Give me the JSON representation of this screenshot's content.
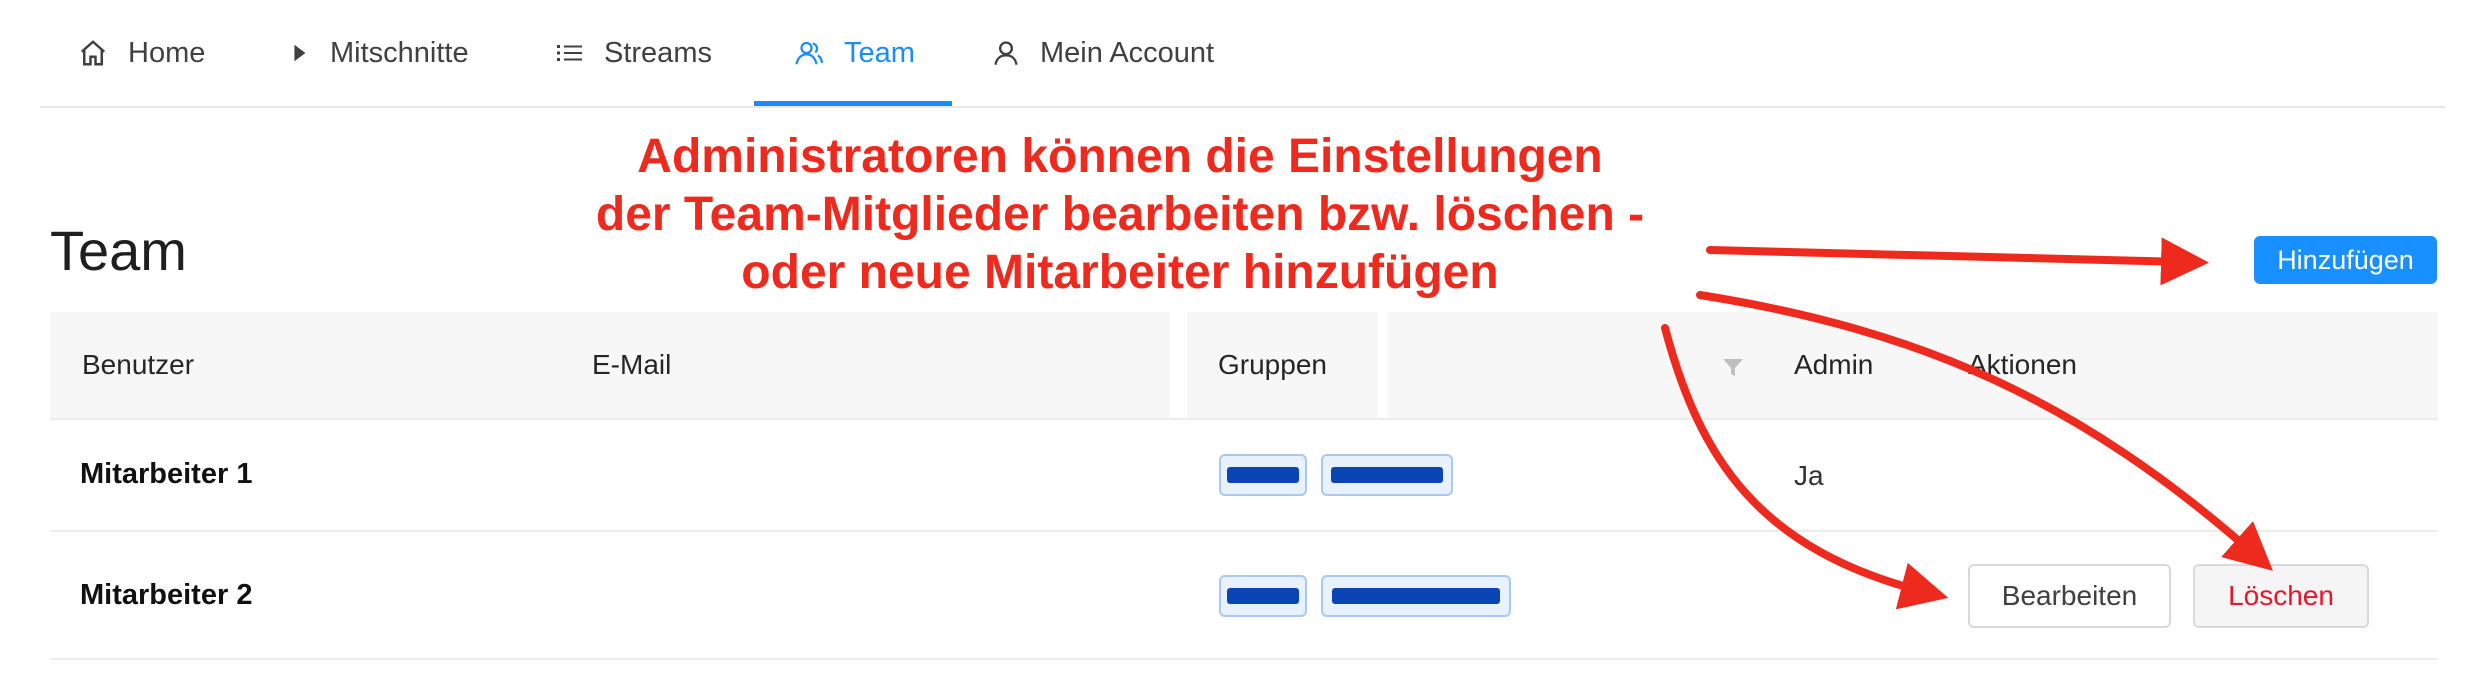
{
  "nav": {
    "items": [
      {
        "label": "Home",
        "icon": "home-icon"
      },
      {
        "label": "Mitschnitte",
        "icon": "play-icon"
      },
      {
        "label": "Streams",
        "icon": "list-icon"
      },
      {
        "label": "Team",
        "icon": "team-icon",
        "active": true
      },
      {
        "label": "Mein Account",
        "icon": "user-icon"
      }
    ]
  },
  "page": {
    "title": "Team",
    "add_button": "Hinzufügen"
  },
  "table": {
    "headers": [
      "Benutzer",
      "E-Mail",
      "Gruppen",
      "Admin",
      "Aktionen"
    ],
    "rows": [
      {
        "user": "Mitarbeiter 1",
        "admin": "Ja"
      },
      {
        "user": "Mitarbeiter 2",
        "admin": "",
        "edit_label": "Bearbeiten",
        "delete_label": "Löschen"
      }
    ]
  },
  "annotation": {
    "lines": [
      "Administratoren können die Einstellungen",
      "der Team-Mitglieder bearbeiten bzw. löschen -",
      "oder neue Mitarbeiter hinzufügen"
    ],
    "color": "#ee2a1e"
  },
  "colors": {
    "accent": "#1890ff",
    "danger": "#e8152b",
    "tag_bg": "#e8f1fe",
    "redaction": "#0b44b4"
  }
}
